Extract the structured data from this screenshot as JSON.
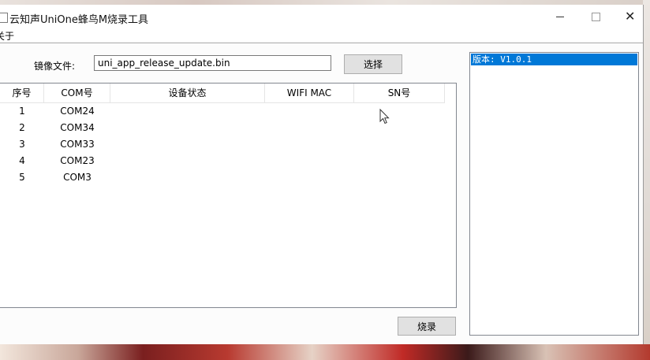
{
  "window": {
    "title": "云知声UniOne蜂鸟M烧录工具",
    "minimize_glyph": "—",
    "maximize_glyph": "☐",
    "close_glyph": "✕"
  },
  "menu": {
    "about": "关于"
  },
  "file": {
    "label": "镜像文件:",
    "value": "uni_app_release_update.bin",
    "select_button": "选择"
  },
  "table": {
    "headers": {
      "seq": "序号",
      "com": "COM号",
      "status": "设备状态",
      "mac": "WIFI MAC",
      "sn": "SN号"
    },
    "rows": [
      {
        "seq": "1",
        "com": "COM24"
      },
      {
        "seq": "2",
        "com": "COM34"
      },
      {
        "seq": "3",
        "com": "COM33"
      },
      {
        "seq": "4",
        "com": "COM23"
      },
      {
        "seq": "5",
        "com": "COM3"
      }
    ]
  },
  "burn_button": "烧录",
  "version_list": {
    "selected": "版本: V1.0.1"
  },
  "colors": {
    "selection": "#0078d7",
    "button_face": "#e1e1e1",
    "border": "#828790"
  }
}
